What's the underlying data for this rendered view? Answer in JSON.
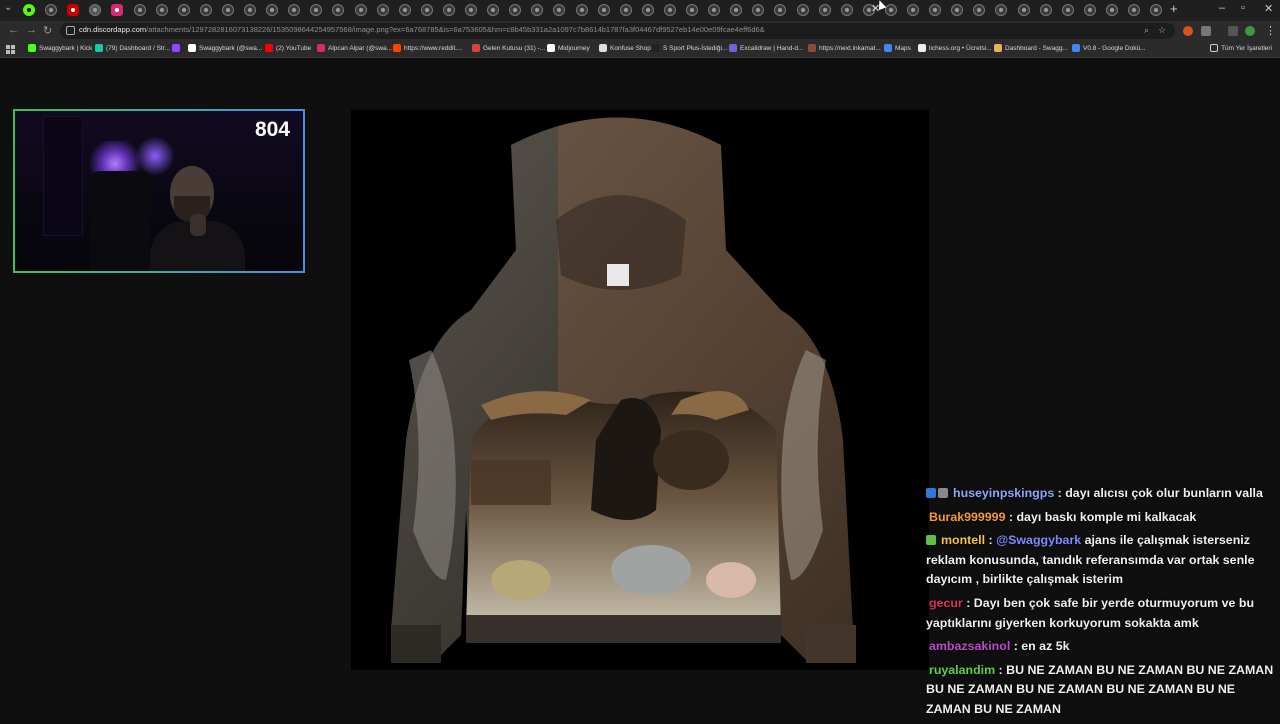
{
  "browser": {
    "url_domain": "cdn.discordapp.com",
    "url_rest": "/attachments/1297282816073138226/1535098644254957568/image.png?ex=6a768785&is=6a753605&hm=c8b45b331a2a1097c7b8614b1787fa3f04467df9527eb14e00e09fcae4eff6d6&",
    "tabs_count": 52,
    "new_tab_label": "+",
    "window_controls": {
      "minimize": "–",
      "maximize": "▫",
      "close": "✕"
    },
    "close_tab_label": "✕"
  },
  "bookmarks": [
    {
      "label": "Swaggybark | Kick",
      "color": "#53fc18"
    },
    {
      "label": "(79) Dashboard / Str...",
      "color": "#1ec7a5"
    },
    {
      "label": "",
      "color": "#9146ff"
    },
    {
      "label": "Swaggybark (@swa...",
      "color": "#ffffff"
    },
    {
      "label": "(2) YouTube",
      "color": "#ff0000"
    },
    {
      "label": "Alpcan Alpar (@swa...",
      "color": "#d62976"
    },
    {
      "label": "https://www.reddit....",
      "color": "#ff4500"
    },
    {
      "label": "Gelen Kutusu (31) -...",
      "color": "#d44638"
    },
    {
      "label": "Midjourney",
      "color": "#ffffff"
    },
    {
      "label": "Konfuse Shop",
      "color": "#dddddd"
    },
    {
      "label": "S Sport Plus-İstediği...",
      "color": "#222222"
    },
    {
      "label": "Excalidraw | Hand-d...",
      "color": "#6965db"
    },
    {
      "label": "https://next.inkamat...",
      "color": "#8a4b38"
    },
    {
      "label": "Maps",
      "color": "#4285f4"
    },
    {
      "label": "lichess.org • Ücretsi...",
      "color": "#eeeeee"
    },
    {
      "label": "Dashboard - Swagg...",
      "color": "#e8b15a"
    },
    {
      "label": "V0.8 - Google Dokü...",
      "color": "#4285f4"
    }
  ],
  "all_bookmarks_label": "Tüm Yer İşaretleri",
  "stream": {
    "viewer_count": "804"
  },
  "chat": [
    {
      "user": "huseyinpskingps",
      "color": "#8ea6ff",
      "badges": [
        "#2b7bd6",
        "#8a8a8a"
      ],
      "parts": [
        {
          "t": " : dayı alıcısı çok olur bunların valla"
        }
      ]
    },
    {
      "user": "Burak999999",
      "color": "#f39c34",
      "badges": [],
      "parts": [
        {
          "t": " : dayı baskı komple mi kalkacak"
        }
      ]
    },
    {
      "user": "montell",
      "color": "#f5c542",
      "badges": [
        "#5fbf4a"
      ],
      "parts": [
        {
          "t": " : "
        },
        {
          "t": "@Swaggybark",
          "mention": true
        },
        {
          "t": " ajans ile çalışmak isterseniz reklam konusunda, tanıdık referansımda var ortak senle dayıcım , birlikte çalışmak isterim"
        }
      ]
    },
    {
      "user": "gecur",
      "color": "#e0315a",
      "badges": [],
      "parts": [
        {
          "t": " : Dayı ben çok safe bir yerde oturmuyorum ve bu yaptıklarını giyerken korkuyorum sokakta amk"
        }
      ]
    },
    {
      "user": "ambazsakinol",
      "color": "#c04ac9",
      "badges": [],
      "parts": [
        {
          "t": " : en az 5k"
        }
      ]
    },
    {
      "user": "ruyalandim",
      "color": "#5fd14a",
      "badges": [],
      "parts": [
        {
          "t": " : BU NE ZAMAN BU NE ZAMAN BU NE ZAMAN BU NE ZAMAN BU NE ZAMAN BU NE ZAMAN BU NE ZAMAN BU NE ZAMAN"
        }
      ]
    }
  ]
}
